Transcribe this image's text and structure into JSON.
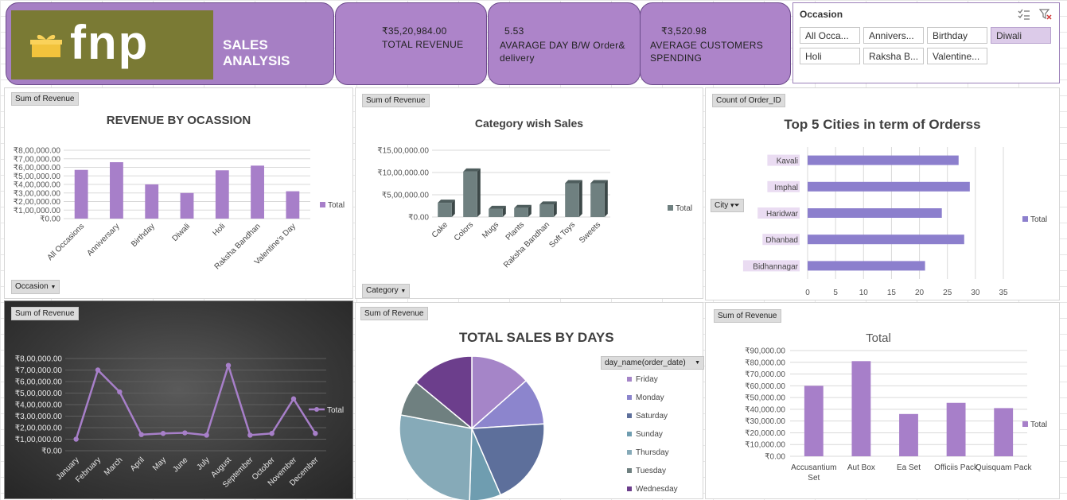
{
  "header": {
    "logo_text": "fnp",
    "title": "SALES ANALYSIS",
    "kpis": [
      {
        "value": "₹35,20,984.00",
        "label": "TOTAL REVENUE"
      },
      {
        "value": "5.53",
        "label": "AVARAGE  DAY B/W Order& delivery"
      },
      {
        "value": "₹3,520.98",
        "label": "AVERAGE  CUSTOMERS SPENDING"
      }
    ]
  },
  "slicer": {
    "title": "Occasion",
    "items": [
      "All Occa...",
      "Annivers...",
      "Birthday",
      "Diwali",
      "Holi",
      "Raksha B...",
      "Valentine..."
    ],
    "selected": "Diwali"
  },
  "colors": {
    "purple": "#a77fc9",
    "slate": "#6f8080",
    "lavender": "#8c7fcd"
  },
  "charts": {
    "occasion": {
      "field_value": "Sum of Revenue",
      "field_axis": "Occasion",
      "legend": "Total"
    },
    "category": {
      "field_value": "Sum of Revenue",
      "field_axis": "Category",
      "legend": "Total"
    },
    "cities": {
      "field_value": "Count of Order_ID",
      "field_axis": "City",
      "legend": "Total"
    },
    "months": {
      "field_value": "Sum of Revenue",
      "legend": "Total"
    },
    "days": {
      "field_value": "Sum of Revenue",
      "field_axis": "day_name(order_date)"
    },
    "products": {
      "field_value": "Sum of Revenue",
      "legend": "Total"
    }
  },
  "chart_data": [
    {
      "id": "occasion",
      "type": "bar",
      "title": "REVENUE BY OCASSION",
      "categories": [
        "All Occasions",
        "Anniversary",
        "Birthday",
        "Diwali",
        "Holi",
        "Raksha Bandhan",
        "Valentine's Day"
      ],
      "series": [
        {
          "name": "Total",
          "values": [
            570000,
            660000,
            400000,
            300000,
            565000,
            620000,
            320000
          ]
        }
      ],
      "ylim": [
        0,
        800000
      ],
      "yticks": [
        "₹0.00",
        "₹1,00,000.00",
        "₹2,00,000.00",
        "₹3,00,000.00",
        "₹4,00,000.00",
        "₹5,00,000.00",
        "₹6,00,000.00",
        "₹7,00,000.00",
        "₹8,00,000.00"
      ],
      "grid": true,
      "legend": "right"
    },
    {
      "id": "category",
      "type": "bar",
      "title": "Category wish Sales",
      "categories": [
        "Cake",
        "Colors",
        "Mugs",
        "Plants",
        "Raksha Bandhan",
        "Soft Toys",
        "Sweets"
      ],
      "series": [
        {
          "name": "Total",
          "values": [
            320000,
            1020000,
            180000,
            200000,
            280000,
            760000,
            760000
          ]
        }
      ],
      "ylim": [
        0,
        1500000
      ],
      "yticks": [
        "₹0.00",
        "₹5,00,000.00",
        "₹10,00,000.00",
        "₹15,00,000.00"
      ],
      "grid": true,
      "legend": "right"
    },
    {
      "id": "cities",
      "type": "bar",
      "title": "Top 5  Cities in term of Orderss",
      "categories": [
        "Kavali",
        "Imphal",
        "Haridwar",
        "Dhanbad",
        "Bidhannagar"
      ],
      "series": [
        {
          "name": "Total",
          "values": [
            27,
            29,
            24,
            28,
            21
          ]
        }
      ],
      "xlim": [
        0,
        35
      ],
      "xticks": [
        "0",
        "5",
        "10",
        "15",
        "20",
        "25",
        "30",
        "35"
      ],
      "grid": true,
      "legend": "right"
    },
    {
      "id": "months",
      "type": "line",
      "title": "",
      "categories": [
        "January",
        "February",
        "March",
        "April",
        "May",
        "June",
        "July",
        "August",
        "September",
        "October",
        "November",
        "December"
      ],
      "series": [
        {
          "name": "Total",
          "values": [
            100000,
            700000,
            510000,
            140000,
            150000,
            155000,
            135000,
            740000,
            135000,
            150000,
            450000,
            150000
          ]
        }
      ],
      "ylim": [
        0,
        800000
      ],
      "yticks": [
        "₹0.00",
        "₹1,00,000.00",
        "₹2,00,000.00",
        "₹3,00,000.00",
        "₹4,00,000.00",
        "₹5,00,000.00",
        "₹6,00,000.00",
        "₹7,00,000.00",
        "₹8,00,000.00"
      ],
      "grid": true,
      "legend": "right"
    },
    {
      "id": "days",
      "type": "pie",
      "title": "TOTAL SALES BY DAYS",
      "categories": [
        "Friday",
        "Monday",
        "Saturday",
        "Sunday",
        "Thursday",
        "Tuesday",
        "Wednesday"
      ],
      "values": [
        13.5,
        10.5,
        19.5,
        7.0,
        27.5,
        8.0,
        14.0
      ],
      "colors": [
        "#a585c8",
        "#8c85cd",
        "#5d6f9b",
        "#6f9db0",
        "#86aab8",
        "#6f8080",
        "#6c3e8c"
      ],
      "legend": "right"
    },
    {
      "id": "products",
      "type": "bar",
      "title": "Total",
      "categories": [
        "Accusantium Set",
        "Aut Box",
        "Ea Set",
        "Officiis Pack",
        "Quisquam Pack"
      ],
      "series": [
        {
          "name": "Total",
          "values": [
            60000,
            81000,
            36000,
            45500,
            41000
          ]
        }
      ],
      "ylim": [
        0,
        90000
      ],
      "yticks": [
        "₹0.00",
        "₹10,000.00",
        "₹20,000.00",
        "₹30,000.00",
        "₹40,000.00",
        "₹50,000.00",
        "₹60,000.00",
        "₹70,000.00",
        "₹80,000.00",
        "₹90,000.00"
      ],
      "grid": true,
      "legend": "right"
    }
  ]
}
